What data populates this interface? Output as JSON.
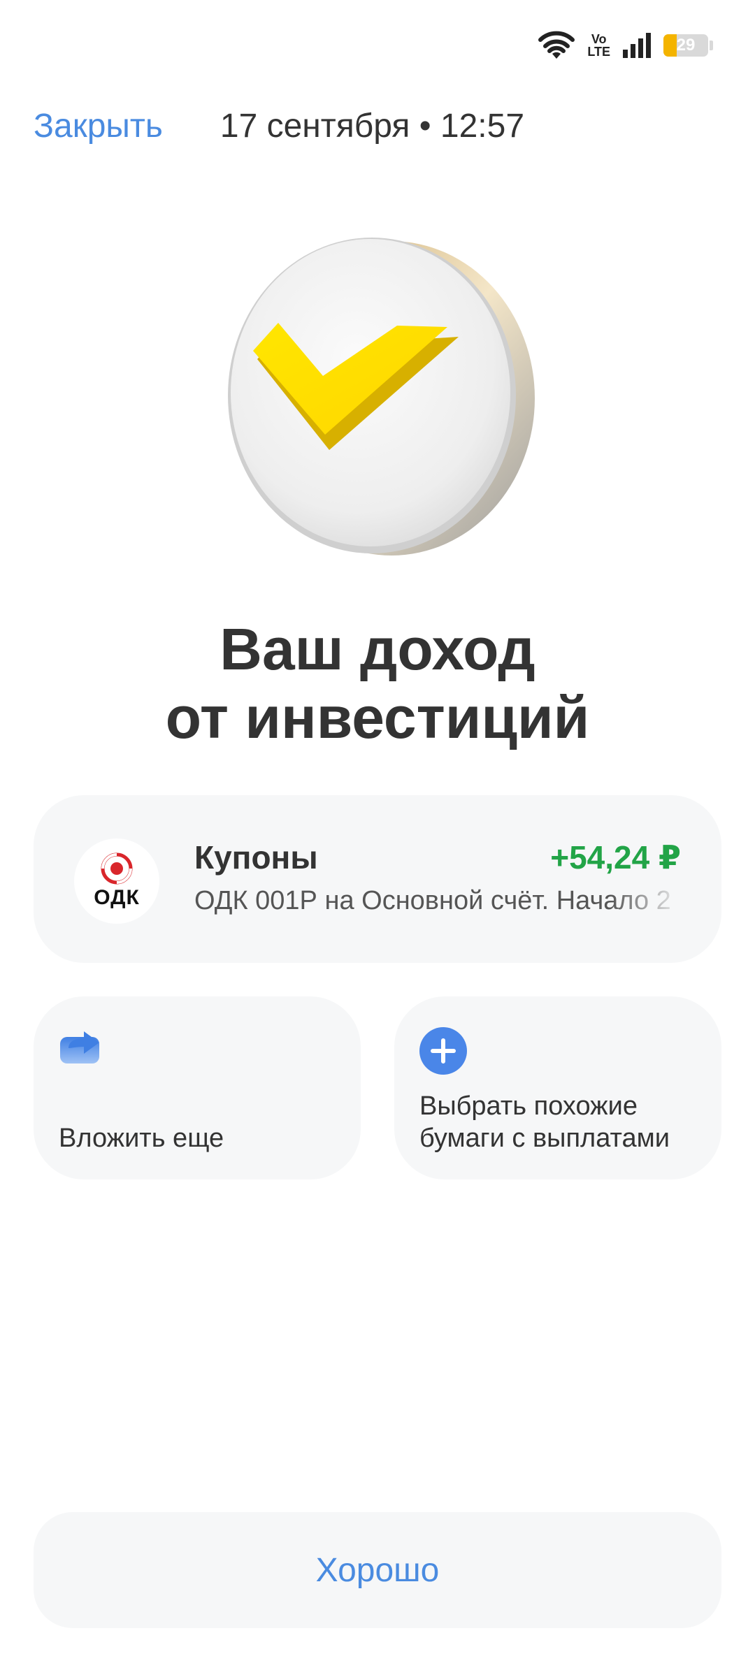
{
  "status": {
    "network_label": "Vo\nLTE",
    "battery_level": "29",
    "battery_color": "#f4b400"
  },
  "header": {
    "close_label": "Закрыть",
    "datetime": "17 сентября • 12:57"
  },
  "hero": {
    "icon": "yellow-checkmark-coin-icon",
    "accent": "#ffe100"
  },
  "title": {
    "line1": "Ваш доход",
    "line2": "от инвестиций"
  },
  "transaction": {
    "logo_text": "ОДК",
    "title": "Купоны",
    "amount": "+54,24 ₽",
    "amount_color": "#22a447",
    "description": "ОДК 001Р на Основной счёт. Начало 2"
  },
  "actions": [
    {
      "icon": "share-arrow-icon",
      "label": "Вложить еще"
    },
    {
      "icon": "plus-circle-icon",
      "label": "Выбрать похожие бумаги с выплатами"
    }
  ],
  "footer": {
    "ok_label": "Хорошо"
  },
  "colors": {
    "link": "#4a8be0",
    "card_bg": "#f6f7f8",
    "text": "#333333"
  }
}
